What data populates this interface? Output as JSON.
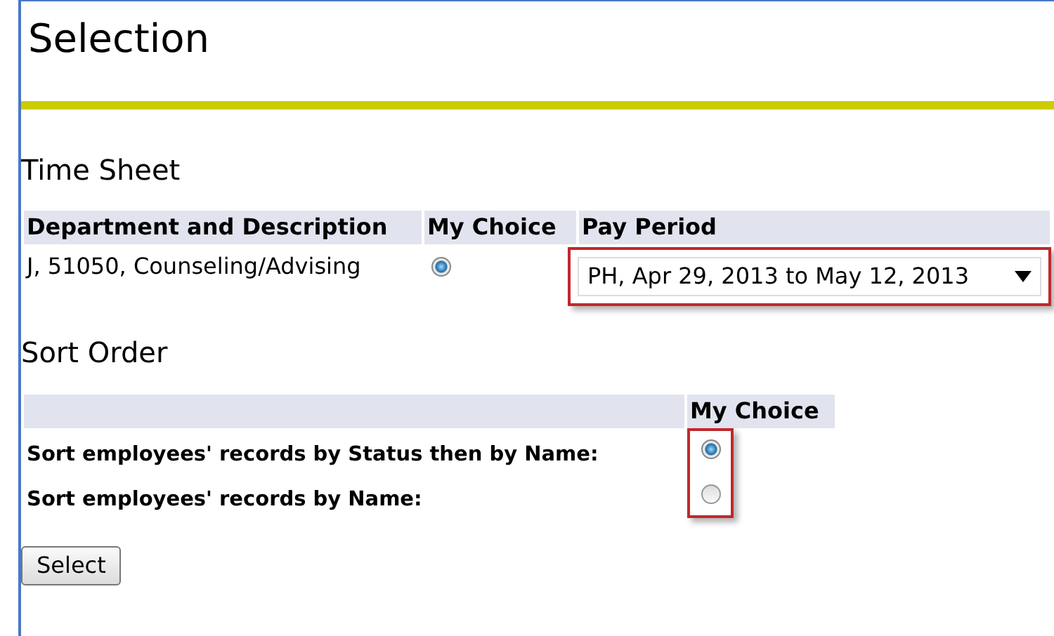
{
  "title": "Selection",
  "time_sheet": {
    "heading": "Time Sheet",
    "columns": [
      "Department and Description",
      "My Choice",
      "Pay Period"
    ],
    "rows": [
      {
        "department": "J, 51050, Counseling/Advising",
        "selected": true,
        "pay_period": "PH, Apr 29, 2013 to May 12, 2013"
      }
    ]
  },
  "sort_order": {
    "heading": "Sort Order",
    "column": "My Choice",
    "options": [
      {
        "label": "Sort employees' records by Status then by Name:",
        "selected": true
      },
      {
        "label": "Sort employees' records by Name:",
        "selected": false
      }
    ]
  },
  "buttons": [
    "Select"
  ]
}
